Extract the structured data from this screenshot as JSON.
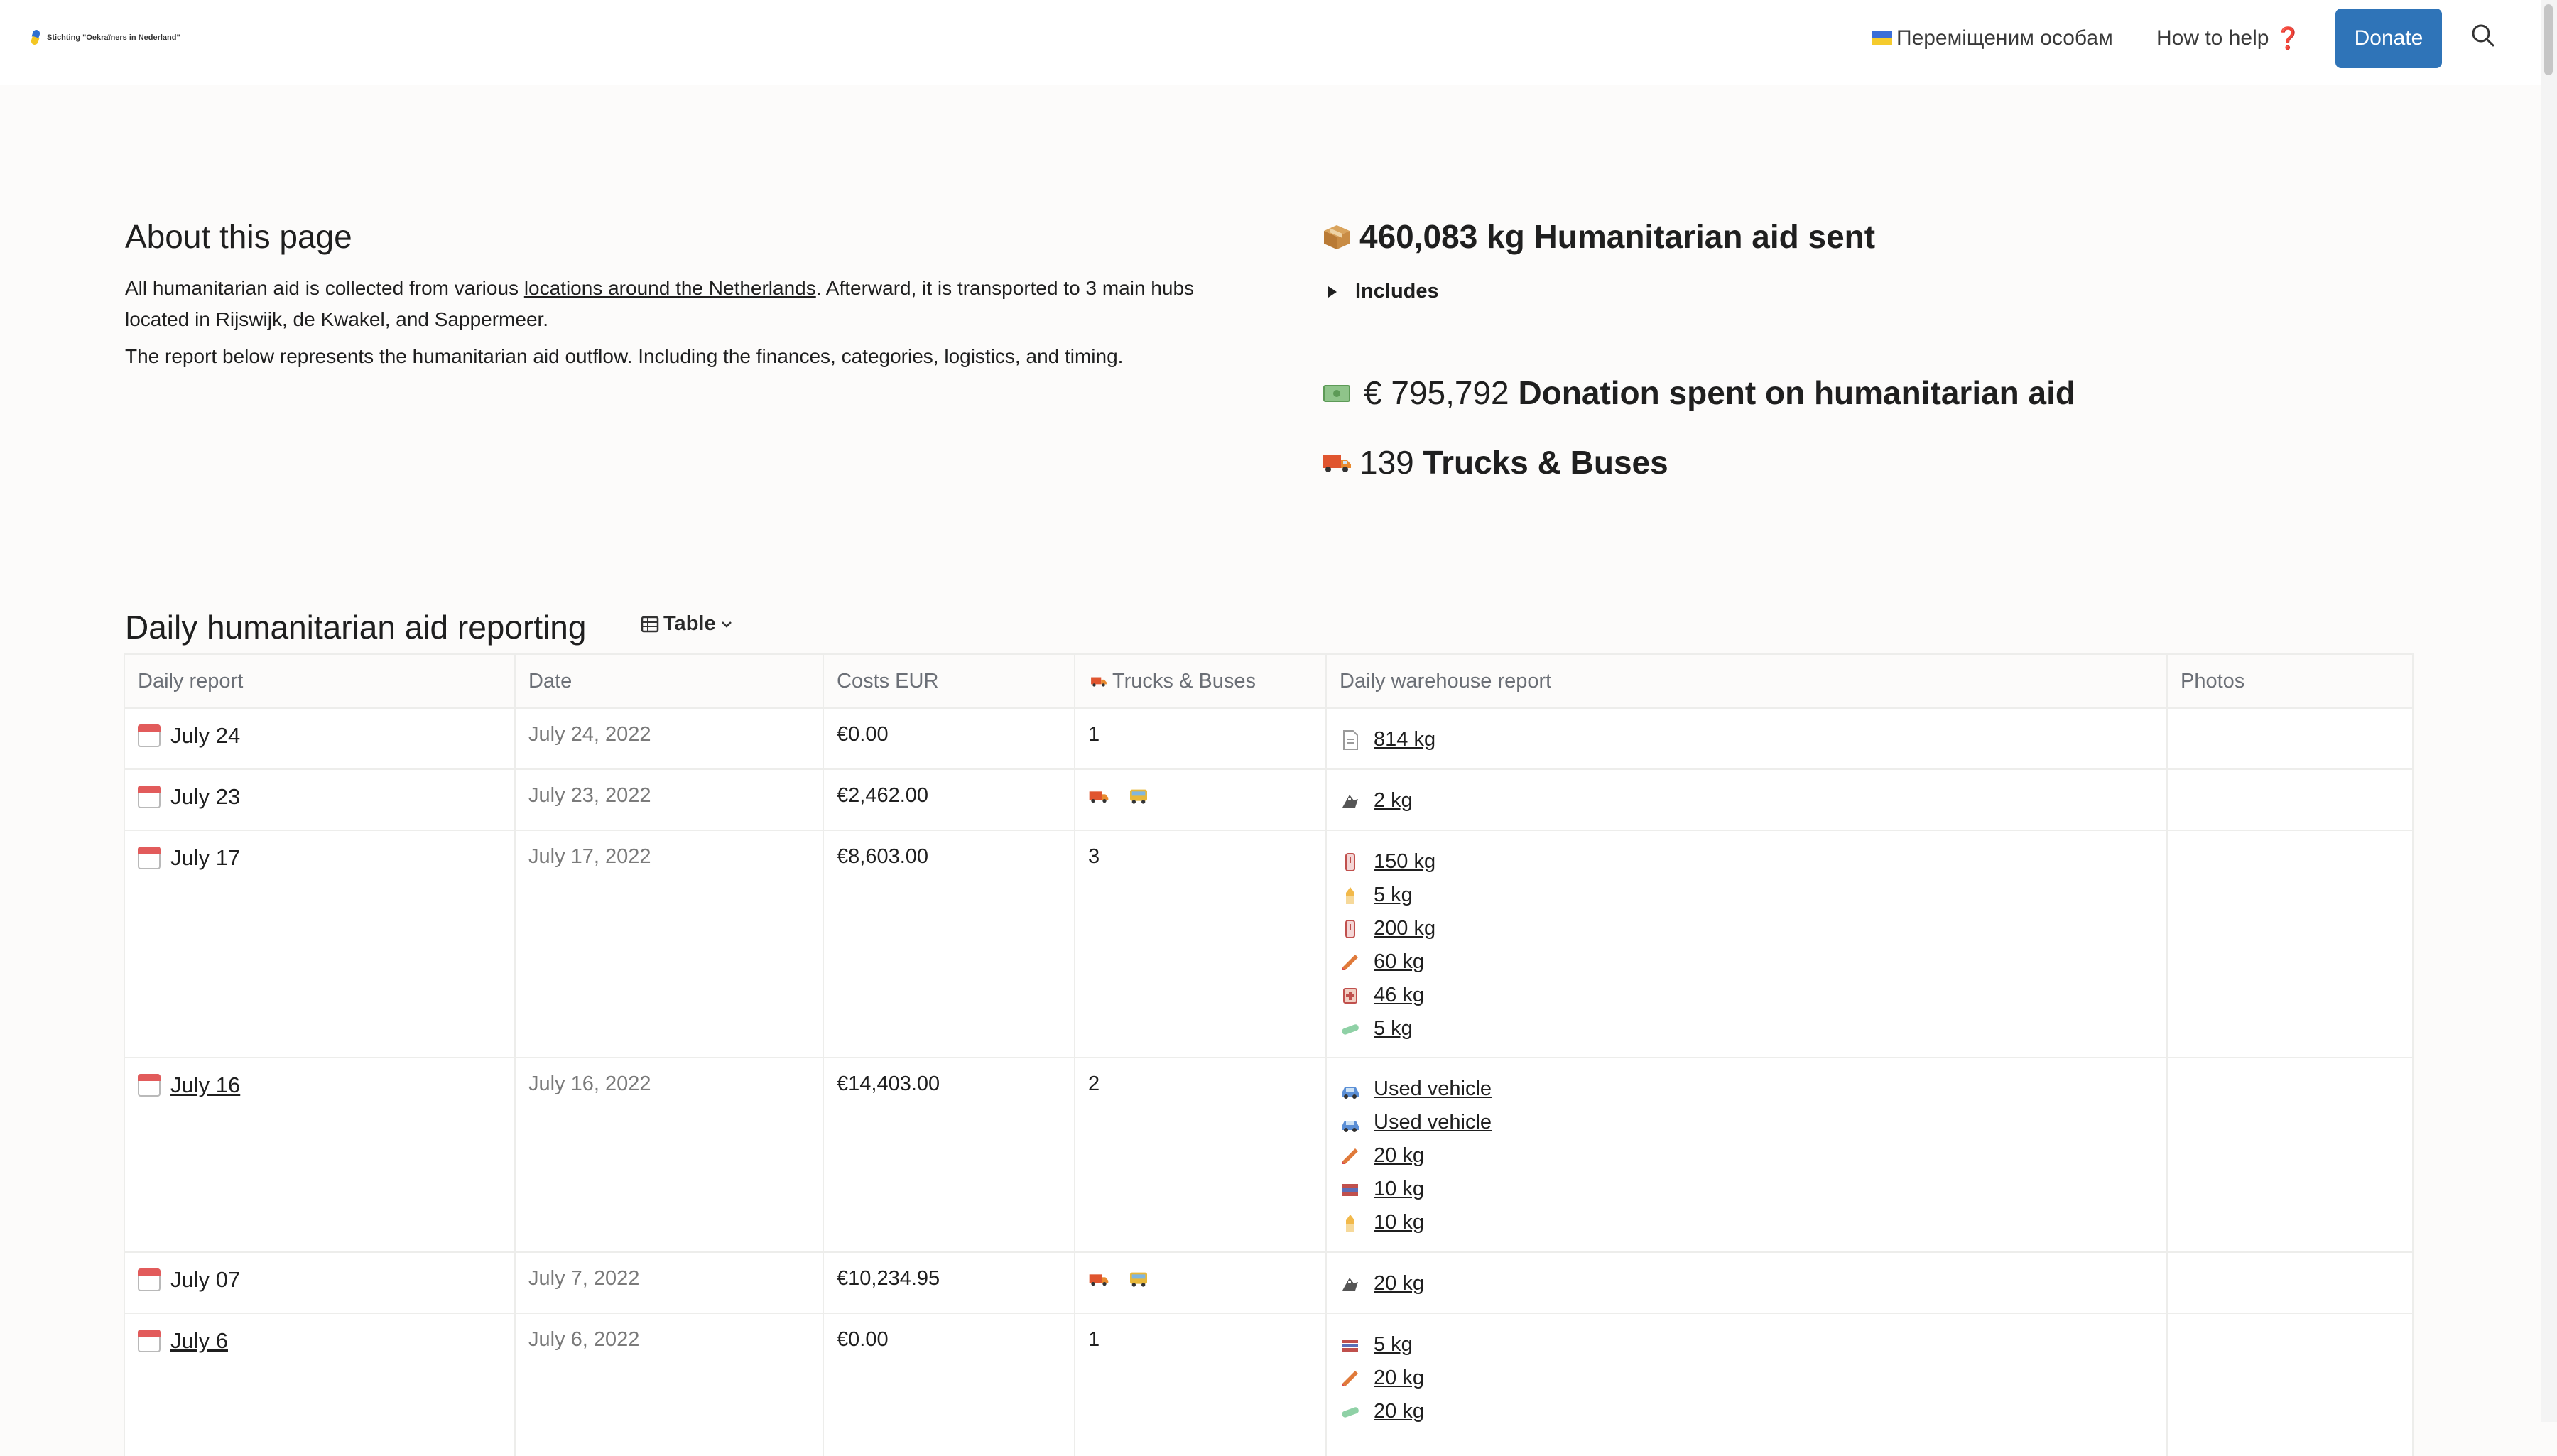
{
  "header": {
    "logo_text": "Stichting \"Oekraïners in Nederland\"",
    "nav_ukr": "Переміщеним особам",
    "nav_help": "How to help",
    "help_mark": "❓",
    "donate": "Donate"
  },
  "about": {
    "title": "About this page",
    "p1_a": "All humanitarian aid is collected from various ",
    "p1_link": "locations around the Netherlands",
    "p1_b": ". Afterward, it is transported to 3 main hubs located in Rijswijk, de Kwakel, and Sappermeer.",
    "p2": "The report below represents the humanitarian aid outflow. Including the finances, categories, logistics, and timing."
  },
  "stats": {
    "aid_value": "460,083 kg",
    "aid_label": "Humanitarian aid sent",
    "includes": "Includes",
    "donation_value": "€ 795,792",
    "donation_label": "Donation spent on humanitarian aid",
    "trucks_value": "139",
    "trucks_label": "Trucks & Buses"
  },
  "table": {
    "title": "Daily humanitarian aid reporting",
    "view": "Table",
    "columns": [
      "Daily report",
      "Date",
      "Costs EUR",
      "Trucks & Buses",
      "Daily warehouse report",
      "Photos"
    ],
    "rows": [
      {
        "name": "July 24",
        "date": "July 24, 2022",
        "cost": "€0.00",
        "trucks": "1",
        "items": [
          "814 kg"
        ]
      },
      {
        "name": "July 23",
        "date": "July 23, 2022",
        "cost": "€2,462.00",
        "trucks": "",
        "items": [
          "2 kg"
        ]
      },
      {
        "name": "July 17",
        "date": "July 17, 2022",
        "cost": "€8,603.00",
        "trucks": "3",
        "items": [
          "150 kg",
          "5 kg",
          "200 kg",
          "60 kg",
          "46 kg",
          "5 kg"
        ]
      },
      {
        "name": "July 16",
        "date": "July 16, 2022",
        "cost": "€14,403.00",
        "trucks": "2",
        "items": [
          "Used vehicle",
          "Used vehicle",
          "20 kg",
          "10 kg",
          "10 kg"
        ]
      },
      {
        "name": "July 07",
        "date": "July 7, 2022",
        "cost": "€10,234.95",
        "trucks": "",
        "items": [
          "20 kg"
        ]
      },
      {
        "name": "July 6",
        "date": "July 6, 2022",
        "cost": "€0.00",
        "trucks": "1",
        "items": [
          "5 kg",
          "20 kg",
          "20 kg"
        ]
      }
    ]
  },
  "icons": {
    "box": "package-icon",
    "money": "money-icon",
    "truck": "truck-icon",
    "calendar": "calendar-icon"
  }
}
